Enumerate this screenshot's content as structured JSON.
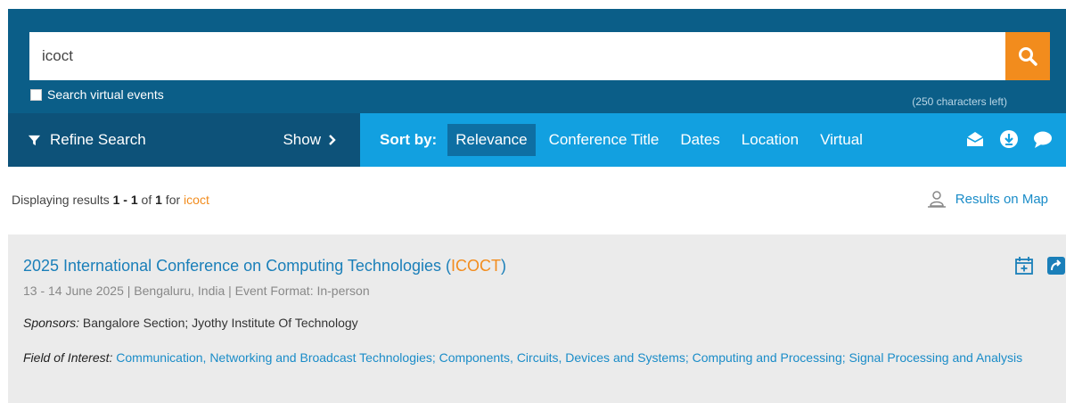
{
  "search": {
    "value": "icoct",
    "virtual_label": "Search virtual events",
    "chars_left": "(250 characters left)",
    "icons": {
      "submit": "search-icon"
    }
  },
  "toolbar": {
    "refine_label": "Refine Search",
    "show_label": "Show",
    "sort_label": "Sort by:",
    "sort_options": [
      "Relevance",
      "Conference Title",
      "Dates",
      "Location",
      "Virtual"
    ],
    "active_sort": "Relevance",
    "icons": [
      "email-icon",
      "download-icon",
      "chat-icon"
    ]
  },
  "results_summary": {
    "prefix": "Displaying results ",
    "from": "1",
    "sep": " - ",
    "to": "1",
    "of": " of ",
    "total": "1",
    "for": " for ",
    "query": "icoct",
    "map_link": "Results on Map"
  },
  "results": [
    {
      "title": "2025 International Conference on Computing Technologies (",
      "acronym": "ICOCT",
      "title_end": ")",
      "meta": "13 - 14 June 2025  |  Bengaluru, India  |  Event Format: In-person",
      "sponsors_label": "Sponsors:",
      "sponsors": " Bangalore Section; Jyothy Institute Of Technology",
      "field_label": "Field of Interest:",
      "field": " Communication, Networking and Broadcast Technologies; Components, Circuits, Devices and Systems; Computing and Processing; Signal Processing and Analysis",
      "icons": [
        "add-calendar-icon",
        "share-icon"
      ]
    }
  ],
  "colors": {
    "header_blue": "#0b5e88",
    "refine_blue": "#0d5279",
    "sort_blue": "#12a0e0",
    "accent_orange": "#f28c1d",
    "link_blue": "#1a7fb9"
  }
}
